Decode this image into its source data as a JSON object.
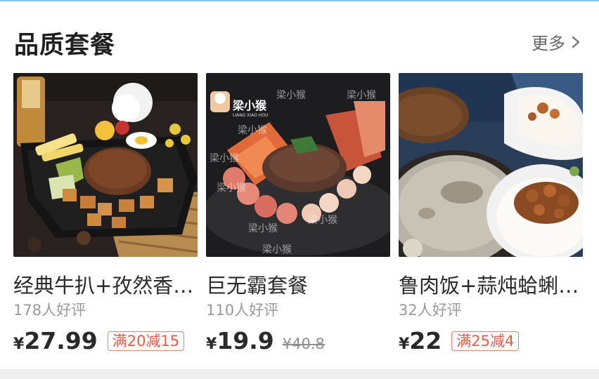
{
  "section": {
    "title": "品质套餐",
    "more_label": "更多"
  },
  "products": [
    {
      "name": "经典牛扒+孜然香…",
      "rating": "178人好评",
      "currency": "¥",
      "price": "27.99",
      "badge": "满20减15",
      "original_price": "",
      "image": "beef-steak-meal-photo"
    },
    {
      "name": "巨无霸套餐",
      "rating": "110人好评",
      "currency": "¥",
      "price": "19.9",
      "badge": "",
      "original_price": "¥40.8",
      "image": "big-platter-meal-photo",
      "watermark": "梁小猴",
      "watermark_sub": "LIANG XIAO HOU"
    },
    {
      "name": "鲁肉饭+蒜炖蛤蜊…",
      "rating": "32人好评",
      "currency": "¥",
      "price": "22",
      "badge": "满25减4",
      "original_price": "",
      "image": "braised-pork-rice-photo"
    }
  ],
  "colors": {
    "accent_red": "#ea5a48",
    "badge_border": "#f07b6e",
    "muted_text": "#9a9a9a",
    "top_line": "#8fc3ef"
  }
}
